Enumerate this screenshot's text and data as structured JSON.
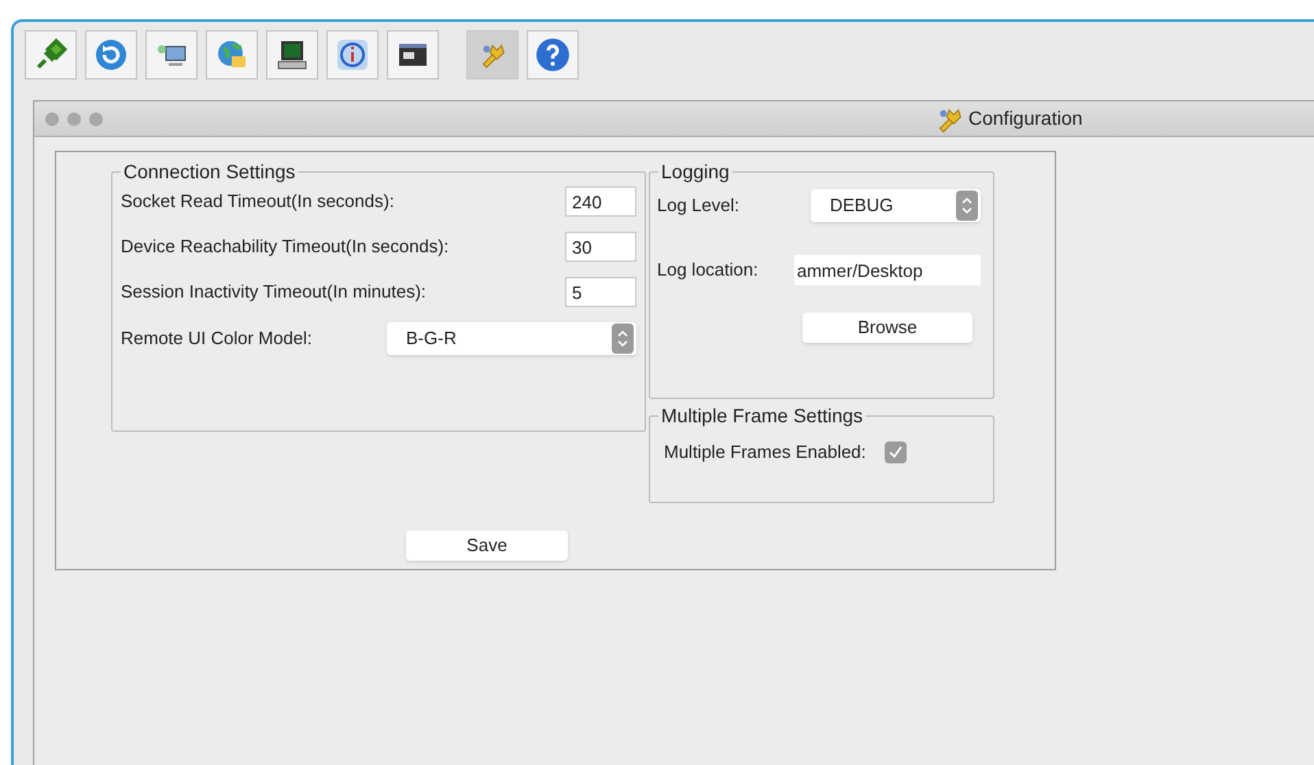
{
  "toolbar": [
    {
      "selected": false
    },
    {
      "selected": false
    },
    {
      "selected": false
    },
    {
      "selected": false
    },
    {
      "selected": false
    },
    {
      "selected": false
    },
    {
      "selected": false
    },
    {
      "selected": true
    },
    {
      "selected": false
    }
  ],
  "window": {
    "title": "Configuration"
  },
  "connection_settings": {
    "title": "Connection Settings",
    "fields": [
      {
        "kind": "text",
        "label": "Socket Read Timeout(In seconds):",
        "value": "240"
      },
      {
        "kind": "text",
        "label": "Device Reachability Timeout(In seconds):",
        "value": "30"
      },
      {
        "kind": "text",
        "label": "Session Inactivity Timeout(In minutes):",
        "value": "5"
      },
      {
        "kind": "select",
        "label": "Remote UI Color Model:",
        "value": "B-G-R"
      }
    ]
  },
  "logging": {
    "title": "Logging",
    "level_label": "Log Level:",
    "level_value": "DEBUG",
    "location_label": "Log location:",
    "location_value": "ammer/Desktop",
    "browse": "Browse"
  },
  "multiple_frames": {
    "title": "Multiple Frame Settings",
    "label": "Multiple Frames Enabled:",
    "checked": true
  },
  "save": "Save"
}
